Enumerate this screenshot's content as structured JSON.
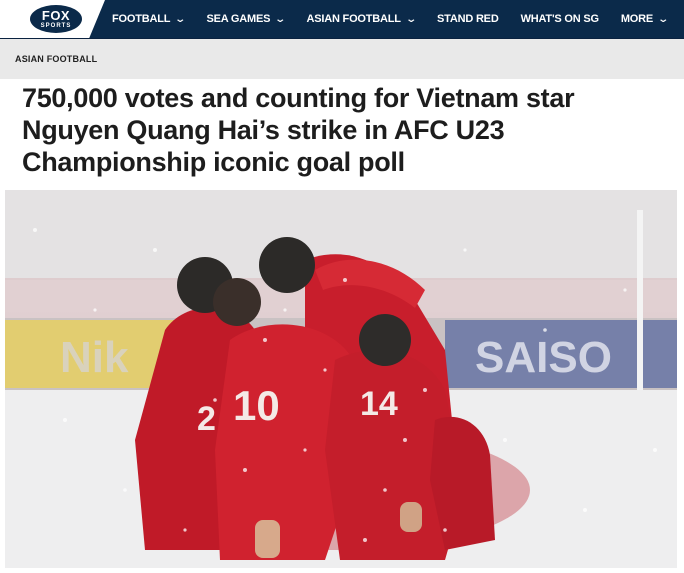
{
  "brand": {
    "logo_top": "FOX",
    "logo_bottom": "SPORTS"
  },
  "nav": {
    "items": [
      {
        "label": "FOOTBALL",
        "has_dropdown": true
      },
      {
        "label": "SEA GAMES",
        "has_dropdown": true
      },
      {
        "label": "ASIAN FOOTBALL",
        "has_dropdown": true
      },
      {
        "label": "STAND RED",
        "has_dropdown": false
      },
      {
        "label": "WHAT'S ON SG",
        "has_dropdown": false
      },
      {
        "label": "MORE",
        "has_dropdown": true
      }
    ],
    "dropdown_icon": "chevron-down-icon"
  },
  "section": {
    "label": "ASIAN FOOTBALL"
  },
  "article": {
    "headline": "750,000 votes and counting for Vietnam star Nguyen Quang Hai’s strike in AFC U23 Championship iconic goal poll"
  },
  "hero": {
    "jersey_numbers": [
      "2",
      "10",
      "14"
    ],
    "ad_board_text": [
      "Nik",
      "SAISO"
    ]
  },
  "colors": {
    "nav_bg": "#0b2a4a",
    "section_bg": "#e9e9e9",
    "jersey_red": "#c81e2c",
    "text": "#1d1d1d"
  }
}
